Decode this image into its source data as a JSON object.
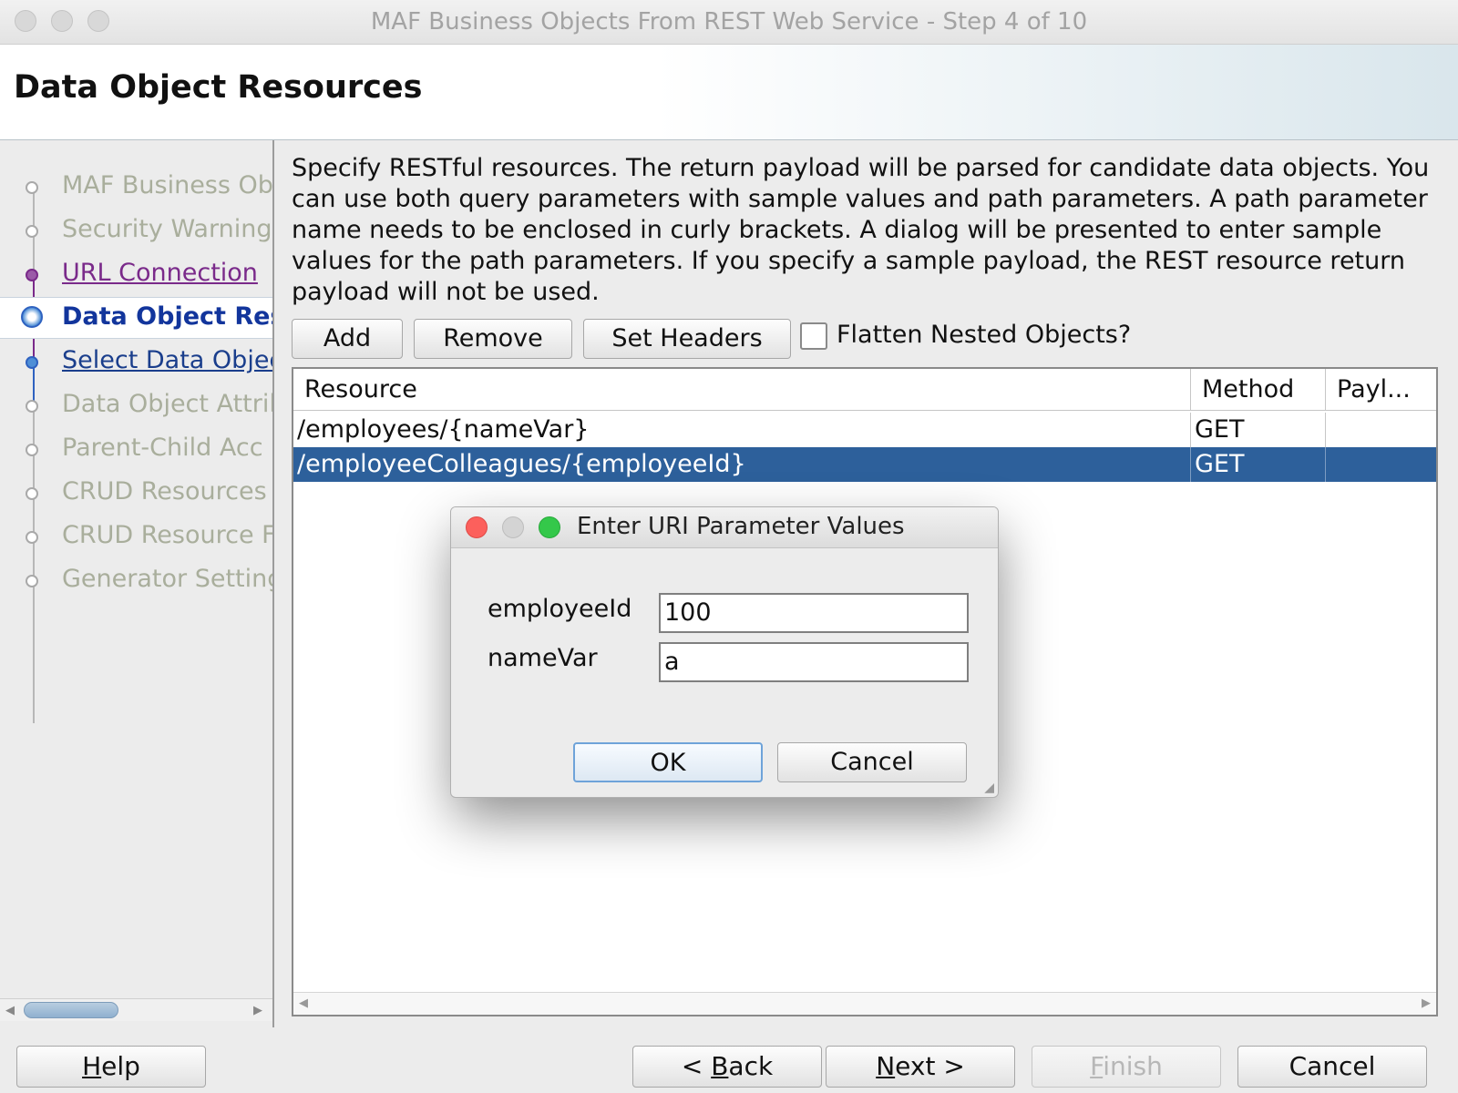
{
  "window": {
    "title": "MAF Business Objects From REST Web Service - Step 4 of 10"
  },
  "header": {
    "title": "Data Object Resources"
  },
  "nav": {
    "items": [
      {
        "label": "MAF Business Ob",
        "state": "disabled"
      },
      {
        "label": "Security Warning",
        "state": "disabled"
      },
      {
        "label": "URL Connection",
        "state": "visited"
      },
      {
        "label": "Data Object Res",
        "state": "current"
      },
      {
        "label": "Select Data Objec",
        "state": "link"
      },
      {
        "label": "Data Object Attril",
        "state": "disabled"
      },
      {
        "label": "Parent-Child Acc",
        "state": "disabled"
      },
      {
        "label": "CRUD Resources",
        "state": "disabled"
      },
      {
        "label": "CRUD Resource F",
        "state": "disabled"
      },
      {
        "label": "Generator Setting",
        "state": "disabled"
      }
    ]
  },
  "main": {
    "description": "Specify RESTful resources. The return payload will be parsed for candidate data objects. You can use both query parameters with sample values and path parameters. A path parameter name needs to be enclosed in curly brackets. A dialog will be presented to enter sample values for the path parameters. If you specify a sample payload, the REST resource return payload will not be used.",
    "toolbar": {
      "add": "Add",
      "remove": "Remove",
      "set_headers": "Set Headers",
      "flatten_label": "Flatten Nested Objects?",
      "flatten_checked": false
    },
    "table": {
      "columns": [
        "Resource",
        "Method",
        "Payl..."
      ],
      "rows": [
        {
          "resource": "/employees/{nameVar}",
          "method": "GET",
          "payload": ""
        },
        {
          "resource": "/employeeColleagues/{employeeId}",
          "method": "GET",
          "payload": "",
          "selected": true
        }
      ]
    }
  },
  "dialog": {
    "title": "Enter URI Parameter Values",
    "fields": [
      {
        "label": "employeeId",
        "value": "100"
      },
      {
        "label": "nameVar",
        "value": "a"
      }
    ],
    "ok": "OK",
    "cancel": "Cancel"
  },
  "footer": {
    "help_pre": "",
    "help_key": "H",
    "help_post": "elp",
    "back_pre": "< ",
    "back_key": "B",
    "back_post": "ack",
    "next_pre": "",
    "next_key": "N",
    "next_post": "ext >",
    "finish_pre": "",
    "finish_key": "F",
    "finish_post": "inish",
    "cancel": "Cancel"
  },
  "colors": {
    "selection": "#2d609b",
    "nav_current": "#12359c",
    "nav_link": "#1a3e8c",
    "nav_visited": "#7a2a8a",
    "close_red": "#fc605c",
    "zoom_green": "#34c84a"
  }
}
